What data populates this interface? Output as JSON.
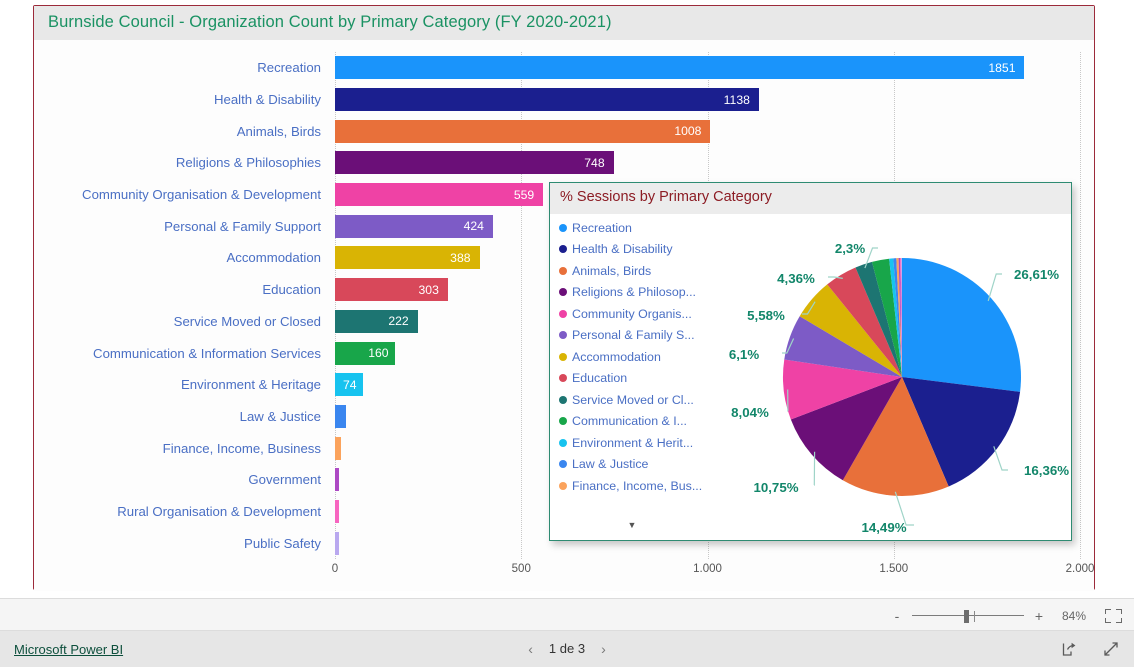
{
  "report": {
    "bar_visual": {
      "title": "Burnside Council - Organization Count by Primary Category (FY 2020-2021)",
      "title_color": "#1a9263",
      "border_color": "#9c2a3a"
    },
    "pie_visual": {
      "title": "% Sessions by Primary Category",
      "title_color": "#8c1c24",
      "border_color": "#2e8b72",
      "legend_scroll_icon": "chevron-down-icon",
      "legend_items": [
        {
          "label": "Recreation",
          "color": "#1a94fb"
        },
        {
          "label": "Health & Disability",
          "color": "#1b1f8f"
        },
        {
          "label": "Animals, Birds",
          "color": "#e8703a"
        },
        {
          "label": "Religions & Philosop...",
          "color": "#6b0f78"
        },
        {
          "label": "Community Organis...",
          "color": "#ef42a5"
        },
        {
          "label": "Personal & Family S...",
          "color": "#7d5bc6"
        },
        {
          "label": "Accommodation",
          "color": "#d9b404"
        },
        {
          "label": "Education",
          "color": "#d8485a"
        },
        {
          "label": "Service Moved or Cl...",
          "color": "#1d7572"
        },
        {
          "label": "Communication & I...",
          "color": "#18a64a"
        },
        {
          "label": "Environment & Herit...",
          "color": "#17c3ef"
        },
        {
          "label": "Law & Justice",
          "color": "#3a86ef"
        },
        {
          "label": "Finance, Income, Bus...",
          "color": "#fba35c"
        }
      ]
    }
  },
  "zoom_toolbar": {
    "minus_label": "-",
    "plus_label": "+",
    "zoom_level": "84%",
    "fit_icon": "fit-to-screen-icon"
  },
  "footer": {
    "brand": "Microsoft Power BI",
    "prev_arrow": "‹",
    "next_arrow": "›",
    "page_indicator": "1 de 3",
    "share_icon": "share-icon",
    "fullscreen_icon": "fullscreen-icon"
  },
  "chart_data": [
    {
      "type": "bar",
      "orientation": "horizontal",
      "title": "Burnside Council - Organization Count by Primary Category (FY 2020-2021)",
      "xlabel": "",
      "ylabel": "",
      "xlim": [
        0,
        2000
      ],
      "grid": true,
      "axis_ticks": [
        "0",
        "500",
        "1.000",
        "1.500",
        "2.000"
      ],
      "axis_tick_values": [
        0,
        500,
        1000,
        1500,
        2000
      ],
      "categories": [
        "Recreation",
        "Health & Disability",
        "Animals, Birds",
        "Religions & Philosophies",
        "Community Organisation & Development",
        "Personal & Family Support",
        "Accommodation",
        "Education",
        "Service Moved or Closed",
        "Communication & Information Services",
        "Environment & Heritage",
        "Law & Justice",
        "Finance, Income, Business",
        "Government",
        "Rural Organisation & Development",
        "Public Safety"
      ],
      "values": [
        1851,
        1138,
        1008,
        748,
        559,
        424,
        388,
        303,
        222,
        160,
        74,
        30,
        17,
        12,
        10,
        5
      ],
      "data_labels": [
        "1851",
        "1138",
        "1008",
        "748",
        "559",
        "424",
        "388",
        "303",
        "222",
        "160",
        "74",
        "",
        "",
        "",
        "",
        ""
      ],
      "colors": [
        "#1a94fb",
        "#1b1f8f",
        "#e8703a",
        "#6b0f78",
        "#ef42a5",
        "#7d5bc6",
        "#d9b404",
        "#d8485a",
        "#1d7572",
        "#18a64a",
        "#17c3ef",
        "#3a86ef",
        "#fba35c",
        "#ad49c4",
        "#f765c0",
        "#b9a8ef"
      ]
    },
    {
      "type": "pie",
      "title": "% Sessions by Primary Category",
      "legend_position": "left",
      "labels": [
        "Recreation",
        "Health & Disability",
        "Animals, Birds",
        "Religions & Philosophies",
        "Community Organisation & Development",
        "Personal & Family Support",
        "Accommodation",
        "Education",
        "Service Moved or Closed",
        "Communication & Information Services",
        "Environment & Heritage",
        "Law & Justice",
        "Finance, Income, Business",
        "Government",
        "Rural Organisation & Development",
        "Public Safety"
      ],
      "values": [
        26.61,
        16.36,
        14.49,
        10.75,
        8.04,
        6.1,
        5.58,
        4.36,
        2.3,
        2.3,
        0.55,
        0.4,
        0.3,
        0.2,
        0.15,
        0.1
      ],
      "displayed_labels": [
        "26,61%",
        "16,36%",
        "14,49%",
        "10,75%",
        "8,04%",
        "6,1%",
        "5,58%",
        "4,36%",
        "2,3%"
      ],
      "colors": [
        "#1a94fb",
        "#1b1f8f",
        "#e8703a",
        "#6b0f78",
        "#ef42a5",
        "#7d5bc6",
        "#d9b404",
        "#d8485a",
        "#1d7572",
        "#18a64a",
        "#17c3ef",
        "#3a86ef",
        "#fba35c",
        "#ad49c4",
        "#f765c0",
        "#b9a8ef"
      ],
      "label_color": "#12866a"
    }
  ]
}
